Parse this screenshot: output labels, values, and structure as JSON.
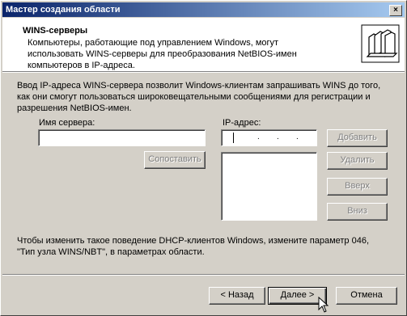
{
  "window": {
    "title": "Мастер создания области",
    "close_glyph": "×"
  },
  "header": {
    "title": "WINS-серверы",
    "subtitle": "Компьютеры, работающие под управлением Windows, могут использовать WINS-серверы для преобразования NetBIOS-имен компьютеров в IP-адреса."
  },
  "body": {
    "intro": "Ввод IP-адреса WINS-сервера позволит Windows-клиентам запрашивать WINS до того, как они смогут пользоваться широковещательными сообщениями для регистрации и разрешения NetBIOS-имен.",
    "server_name_label": "Имя сервера:",
    "server_name_value": "",
    "ip_label": "IP-адрес:",
    "ip_value": ". . .",
    "resolve_button": "Сопоставить",
    "add_button": "Добавить",
    "remove_button": "Удалить",
    "up_button": "Вверх",
    "down_button": "Вниз",
    "footer_note": "Чтобы изменить такое поведение DHCP-клиентов Windows, измените параметр 046, \"Тип узла WINS/NBT\", в параметрах области."
  },
  "wizard_buttons": {
    "back": "< Назад",
    "next": "Далее >",
    "cancel": "Отмена"
  },
  "icons": [
    "close-icon",
    "wizard-folders-icon",
    "mouse-pointer-icon"
  ]
}
